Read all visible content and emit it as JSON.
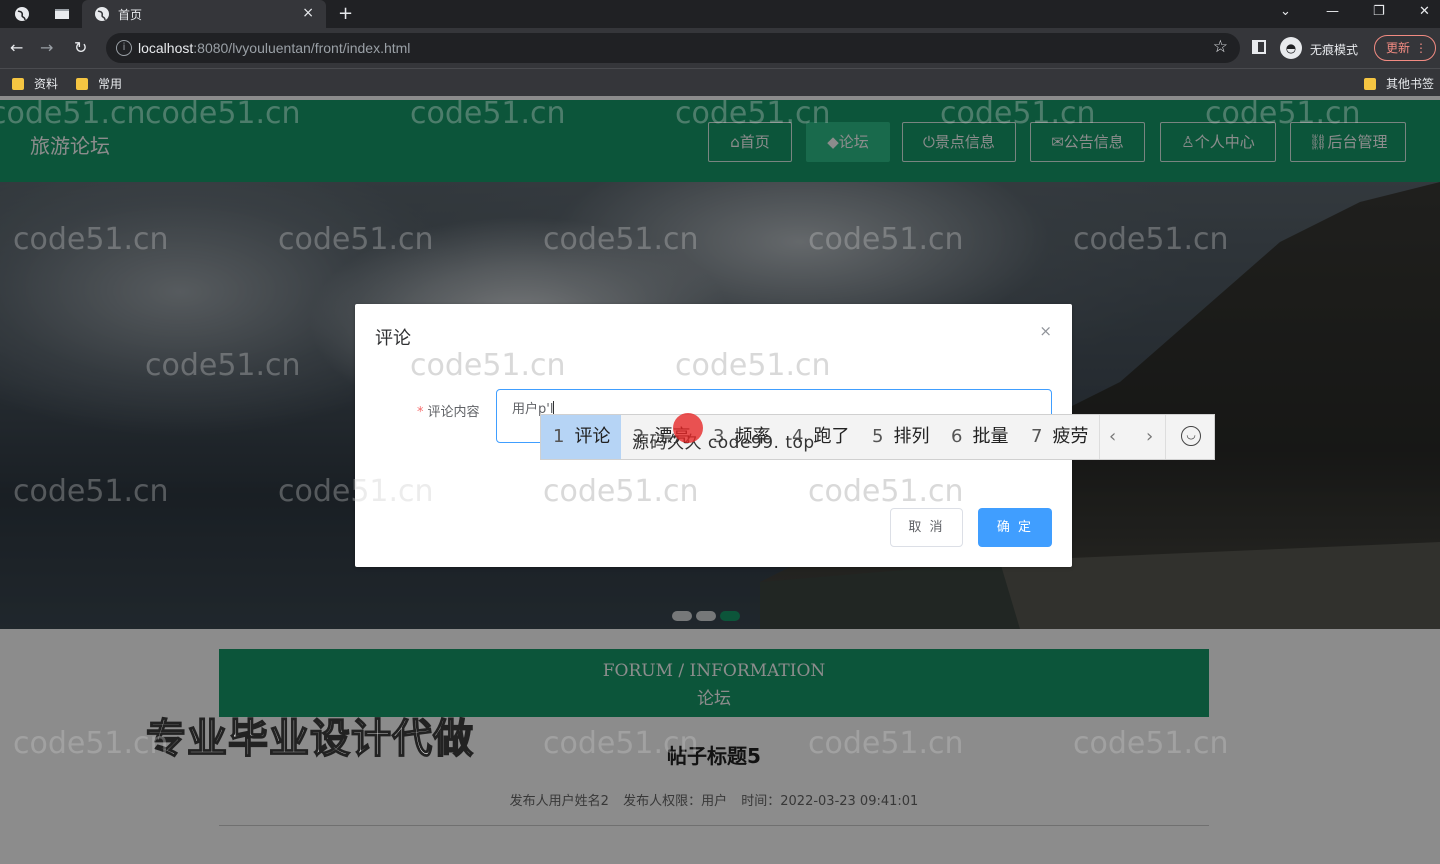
{
  "browser": {
    "tab_title": "首页",
    "tab_close": "×",
    "new_tab": "+",
    "url_host": "localhost",
    "url_rest": ":8080/lvyouluentan/front/index.html",
    "incognito_label": "无痕模式",
    "update_label": "更新",
    "bookmarks": [
      "资料",
      "常用"
    ],
    "other_bookmarks": "其他书签"
  },
  "site": {
    "logo": "旅游论坛",
    "nav": [
      {
        "label": "首页",
        "icon": "home-icon",
        "active": false
      },
      {
        "label": "论坛",
        "icon": "graduation-cap-icon",
        "active": true
      },
      {
        "label": "景点信息",
        "icon": "power-icon",
        "active": false
      },
      {
        "label": "公告信息",
        "icon": "mail-icon",
        "active": false
      },
      {
        "label": "个人中心",
        "icon": "user-icon",
        "active": false
      },
      {
        "label": "后台管理",
        "icon": "link-icon",
        "active": false
      }
    ],
    "accent_color": "#179b6b"
  },
  "forum": {
    "banner_en": "FORUM / INFORMATION",
    "banner_zh": "论坛",
    "ad_text": "专业毕业设计代做",
    "post_title": "帖子标题5",
    "post_author": "发布人用户姓名2",
    "post_role": "发布人权限：用户",
    "post_time": "时间：2022-03-23 09:41:01"
  },
  "dialog": {
    "title": "评论",
    "close": "×",
    "field_label": "评论内容",
    "required_mark": "*",
    "input_value": "用户p'l",
    "cancel_label": "取 消",
    "ok_label": "确 定"
  },
  "ime": {
    "candidates": [
      {
        "num": "1",
        "text": "评论"
      },
      {
        "num": "2",
        "text": "漂亮"
      },
      {
        "num": "3",
        "text": "频率"
      },
      {
        "num": "4",
        "text": "跑了"
      },
      {
        "num": "5",
        "text": "排列"
      },
      {
        "num": "6",
        "text": "批量"
      },
      {
        "num": "7",
        "text": "疲劳"
      }
    ],
    "overlay_text": "源码久久 code99. top"
  },
  "watermark": "code51.cn"
}
